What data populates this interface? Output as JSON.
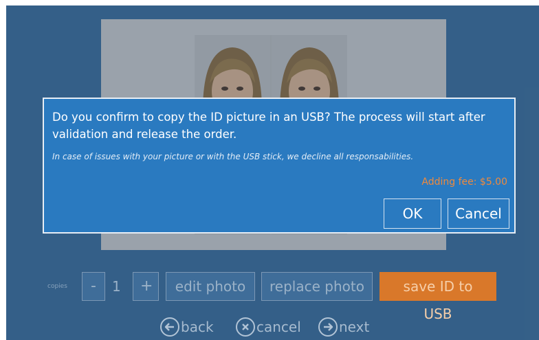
{
  "dialog": {
    "message": "Do you confirm to copy the ID picture in an USB? The process will start after validation and release the order.",
    "note": "In case of issues with your picture or with the USB stick, we decline all responsabilities.",
    "fee": "Adding fee: $5.00",
    "ok_label": "OK",
    "cancel_label": "Cancel"
  },
  "controls": {
    "copies_label": "copies",
    "minus_label": "-",
    "copies_value": "1",
    "plus_label": "+",
    "edit_label": "edit photo",
    "replace_label": "replace photo",
    "save_label": "save ID to USB"
  },
  "nav": {
    "back_label": "back",
    "cancel_label": "cancel",
    "next_label": "next",
    "back_icon": "arrow-left-circle",
    "cancel_icon": "x-circle",
    "next_icon": "arrow-right-circle"
  },
  "colors": {
    "background": "#3a6a96",
    "dialog": "#2a7ac0",
    "accent": "#d9782a",
    "fee": "#f08a3c"
  }
}
